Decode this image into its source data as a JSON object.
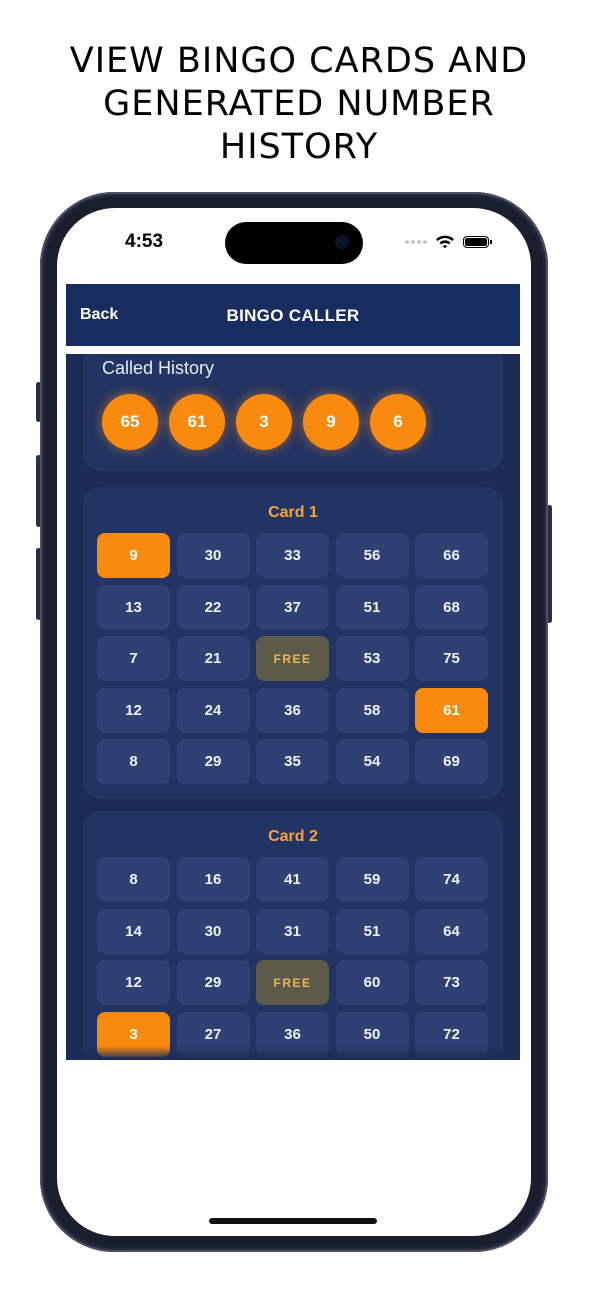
{
  "promo": {
    "line1": "VIEW BINGO CARDS AND",
    "line2": "GENERATED NUMBER",
    "line3": "HISTORY"
  },
  "status_bar": {
    "time": "4:53"
  },
  "nav": {
    "back_label": "Back",
    "title": "BINGO CALLER"
  },
  "history": {
    "title": "Called History",
    "balls": [
      "65",
      "61",
      "3",
      "9",
      "6"
    ]
  },
  "colors": {
    "accent": "#fa8a0d",
    "card_title": "#f6a33c",
    "background": "#1c2b55",
    "navbar": "#172d5f"
  },
  "cards": [
    {
      "title": "Card 1",
      "cells": [
        [
          "9",
          "30",
          "33",
          "56",
          "66"
        ],
        [
          "13",
          "22",
          "37",
          "51",
          "68"
        ],
        [
          "7",
          "21",
          "FREE",
          "53",
          "75"
        ],
        [
          "12",
          "24",
          "36",
          "58",
          "61"
        ],
        [
          "8",
          "29",
          "35",
          "54",
          "69"
        ]
      ],
      "marked": [
        "9",
        "61"
      ]
    },
    {
      "title": "Card 2",
      "cells": [
        [
          "8",
          "16",
          "41",
          "59",
          "74"
        ],
        [
          "14",
          "30",
          "31",
          "51",
          "64"
        ],
        [
          "12",
          "29",
          "FREE",
          "60",
          "73"
        ],
        [
          "3",
          "27",
          "36",
          "50",
          "72"
        ]
      ],
      "marked": [
        "3"
      ]
    }
  ]
}
